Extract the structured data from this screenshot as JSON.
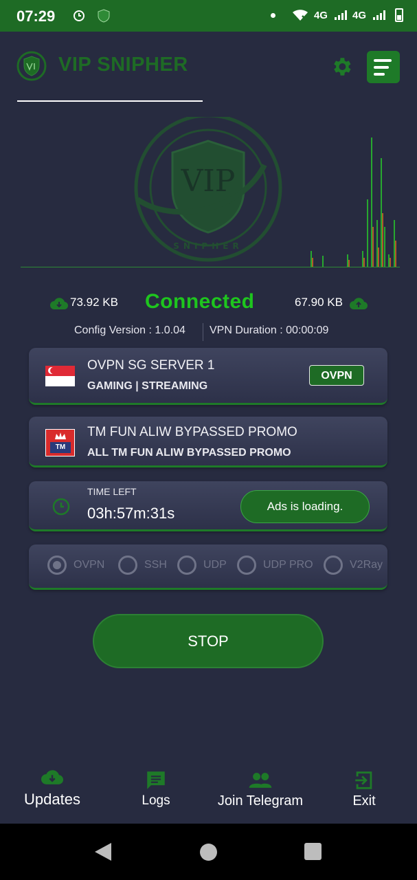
{
  "status_bar": {
    "time": "07:29",
    "network_1": "4G",
    "network_2": "4G"
  },
  "header": {
    "title": "VIP SNIPHER",
    "settings_icon": "gear-icon",
    "menu_icon": "menu-icon"
  },
  "stats": {
    "download": "73.92 KB",
    "upload": "67.90 KB",
    "status": "Connected",
    "config_version": "Config Version : 1.0.04",
    "vpn_duration": "VPN Duration : 00:00:09"
  },
  "server": {
    "name": "OVPN SG SERVER 1",
    "subtitle": "GAMING | STREAMING",
    "protocol": "OVPN"
  },
  "payload": {
    "name": "TM FUN ALIW BYPASSED PROMO",
    "subtitle": "ALL TM FUN ALIW BYPASSED PROMO",
    "logo_text": "TM"
  },
  "timer": {
    "label": "TIME LEFT",
    "value": "03h:57m:31s",
    "ads_button": "Ads is loading."
  },
  "protocols": {
    "selected": "OVPN",
    "options": [
      "OVPN",
      "SSH",
      "UDP",
      "UDP PRO",
      "V2Ray"
    ]
  },
  "main_button": "STOP",
  "bottom_nav": [
    {
      "label": "Updates",
      "icon": "cloud-download-icon"
    },
    {
      "label": "Logs",
      "icon": "chat-icon"
    },
    {
      "label": "Join Telegram",
      "icon": "group-icon"
    },
    {
      "label": "Exit",
      "icon": "exit-icon"
    }
  ],
  "logo_text": {
    "top": "VIP",
    "bottom": "SNIPHER"
  },
  "colors": {
    "background": "#272b40",
    "accent": "#1e6b25",
    "connected": "#1ec51e"
  }
}
